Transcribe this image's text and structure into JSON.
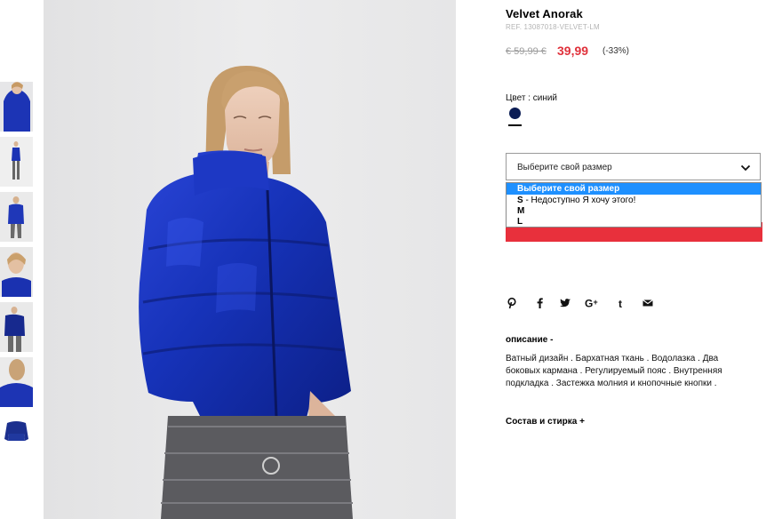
{
  "product": {
    "title": "Velvet Anorak",
    "ref": "REF. 13087018-VELVET-LM",
    "price_old": "€ 59,99 €",
    "price_new": "39,99",
    "discount": "(-33%)"
  },
  "color": {
    "label": "Цвет : синий",
    "swatch_hex": "#0b1d55"
  },
  "size_select": {
    "placeholder": "Выберите свой размер",
    "options": [
      {
        "size": "",
        "text": "Выберите свой размер",
        "selected": true
      },
      {
        "size": "S",
        "text": " - Недоступно Я хочу этого!",
        "selected": false
      },
      {
        "size": "M",
        "text": "",
        "selected": false
      },
      {
        "size": "L",
        "text": "",
        "selected": false
      }
    ]
  },
  "accent_color": "#e8303c",
  "share_icons": [
    "pinterest-icon",
    "facebook-icon",
    "twitter-icon",
    "google-plus-icon",
    "tumblr-icon",
    "email-icon"
  ],
  "description": {
    "heading": "описание  -",
    "text": "Ватный дизайн . Бархатная ткань . Водолазка . Два боковых кармана . Регулируемый пояс . Внутренняя подкладка . Застежка молния и кнопочные кнопки ."
  },
  "composition": {
    "heading": "Состав и стирка  +"
  }
}
